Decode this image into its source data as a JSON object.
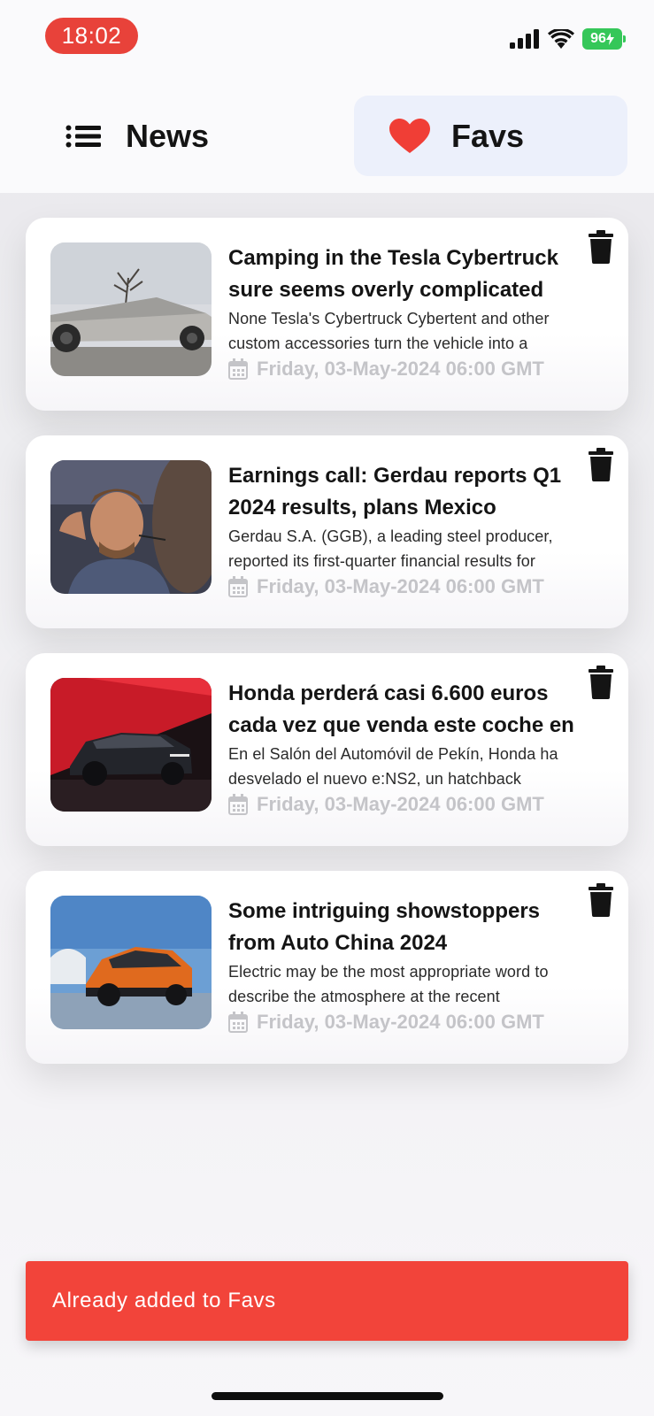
{
  "status_bar": {
    "time": "18:02",
    "battery": "96",
    "icons": [
      "cellular-signal-icon",
      "wifi-icon",
      "battery-charging-icon"
    ]
  },
  "tabs": [
    {
      "label": "News",
      "icon": "list-icon",
      "active": false
    },
    {
      "label": "Favs",
      "icon": "heart-icon",
      "active": true
    }
  ],
  "articles": [
    {
      "title": "Camping in the Tesla Cybertruck sure seems overly complicated",
      "description": "None Tesla's Cybertruck Cybertent and other custom accessories turn the vehicle into a",
      "date": "Friday, 03-May-2024 06:00 GMT",
      "image": "silver cybertruck parked under a bare tree"
    },
    {
      "title": "Earnings call: Gerdau reports Q1 2024 results, plans Mexico",
      "description": "Gerdau S.A. (GGB), a leading steel producer, reported its first-quarter financial results for",
      "date": "Friday, 03-May-2024 06:00 GMT",
      "image": "stressed trader with headset on a trading floor"
    },
    {
      "title": "Honda perderá casi 6.600 euros cada vez que venda este coche en",
      "description": "En el Salón del Automóvil de Pekín, Honda ha desvelado el nuevo e:NS2, un hatchback",
      "date": "Friday, 03-May-2024 06:00 GMT",
      "image": "dark crossover car against red background"
    },
    {
      "title": "Some intriguing showstoppers from Auto China 2024",
      "description": "Electric may be the most appropriate word to describe the atmosphere at the recent",
      "date": "Friday, 03-May-2024 06:00 GMT",
      "image": "orange compact SUV under blue sky"
    }
  ],
  "snackbar": {
    "message": "Already added to Favs"
  },
  "colors": {
    "accent_red": "#f2443a",
    "time_pill": "#e8423a",
    "battery_green": "#35c759",
    "active_tab_bg": "#ecf0fb",
    "date_gray": "#c4c4c8"
  }
}
